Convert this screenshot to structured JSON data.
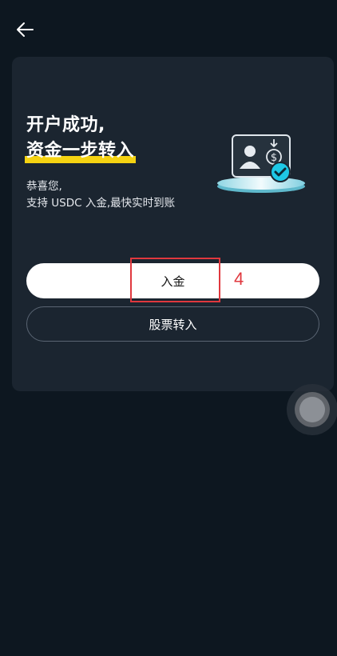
{
  "nav": {
    "back_icon": "arrow-left-icon"
  },
  "headline": {
    "line1": "开户成功,",
    "line2": "资金一步转入"
  },
  "subtitle": {
    "line1": "恭喜您,",
    "line2": "支持 USDC 入金,最快实时到账"
  },
  "illustration": {
    "icon": "user-card-dollar-check-icon",
    "accent": "#1ec8e6"
  },
  "buttons": {
    "deposit_label": "入金",
    "stock_transfer_label": "股票转入"
  },
  "annotation": {
    "label": "4",
    "color": "#e0383e"
  },
  "floating": {
    "icon": "assistive-touch-icon"
  },
  "colors": {
    "background": "#0d1720",
    "card": "#1b2530",
    "highlight": "#f5d312"
  }
}
